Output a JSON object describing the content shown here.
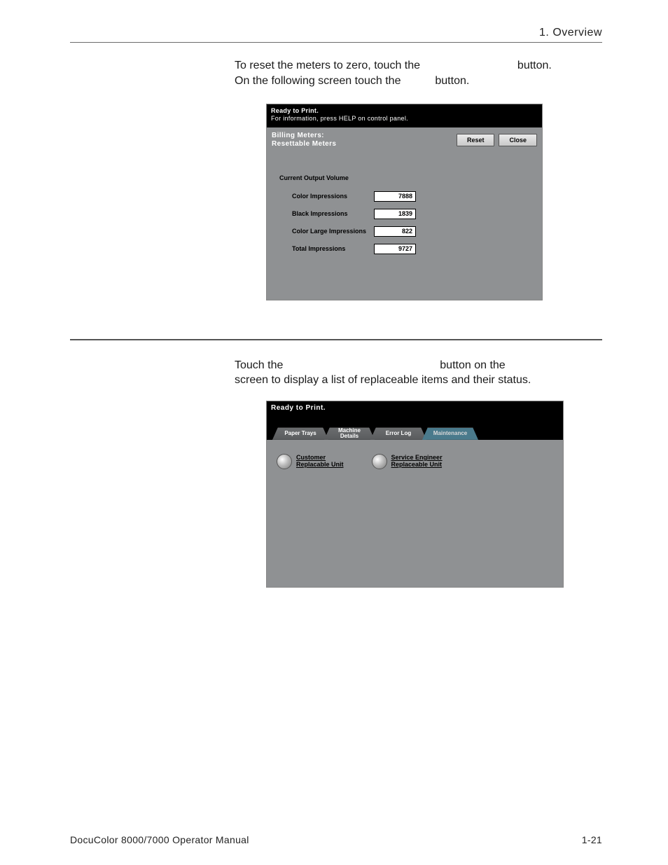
{
  "header": {
    "chapter": "1. Overview"
  },
  "paragraph1": {
    "line1a": "To reset the meters to zero, touch the ",
    "line1b": " button.",
    "line2a": "On the following screen touch the ",
    "line2b": " button."
  },
  "screenshot1": {
    "status_line1": "Ready to Print.",
    "status_line2": "For information, press HELP on control panel.",
    "panel_title_line1": "Billing Meters:",
    "panel_title_line2": "Resettable Meters",
    "btn_reset": "Reset",
    "btn_close": "Close",
    "section_title": "Current Output Volume",
    "rows": [
      {
        "label": "Color Impressions",
        "value": "7888"
      },
      {
        "label": "Black Impressions",
        "value": "1839"
      },
      {
        "label": "Color Large Impressions",
        "value": "822"
      },
      {
        "label": "Total Impressions",
        "value": "9727"
      }
    ]
  },
  "paragraph2": {
    "line1a": "Touch the ",
    "line1b": " button on the",
    "line2": "screen to display a list of replaceable items and their status."
  },
  "screenshot2": {
    "status_line1": "Ready to Print.",
    "tabs": {
      "t1": "Paper Trays",
      "t2": "Machine\nDetails",
      "t3": "Error Log",
      "t4": "Maintenance"
    },
    "options": {
      "o1_line1": "Customer",
      "o1_line2": "Replacable Unit",
      "o2_line1": "Service Engineer",
      "o2_line2": "Replaceable Unit"
    }
  },
  "footer": {
    "left": "DocuColor 8000/7000 Operator Manual",
    "right": "1-21"
  }
}
